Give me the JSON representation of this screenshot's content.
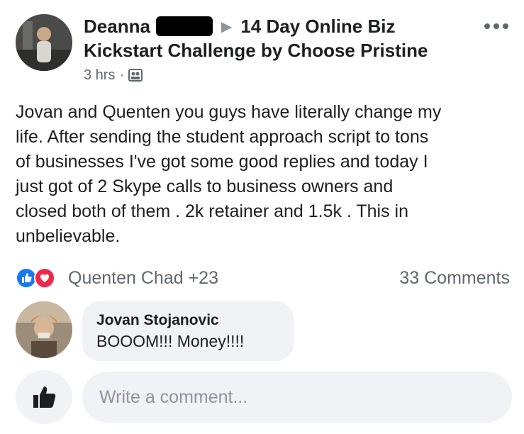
{
  "post": {
    "author_name": "Deanna",
    "group_name": "14 Day Online Biz",
    "group_name_line2": "Kickstart Challenge by Choose Pristine",
    "timestamp": "3 hrs",
    "separator": "·",
    "icons": {
      "arrow": "triangle-right-icon",
      "audience": "group-icon",
      "more": "more-options-icon"
    },
    "body": "Jovan and Quenten you guys have literally change my\nlife. After sending the student approach script to tons\nof businesses I've got some good replies and today I\njust got of 2 Skype calls to business owners and\nclosed both of them .   2k retainer and 1.5k . This in\nunbelievable."
  },
  "reactions": {
    "names": "Quenten Chad +23",
    "comments_count": "33 Comments",
    "colors": {
      "like": "#1877f2",
      "love": "#f0284a"
    }
  },
  "comments": [
    {
      "author": "Jovan Stojanovic",
      "text": "BOOOM!!! Money!!!!"
    }
  ],
  "composer": {
    "placeholder": "Write a comment..."
  }
}
